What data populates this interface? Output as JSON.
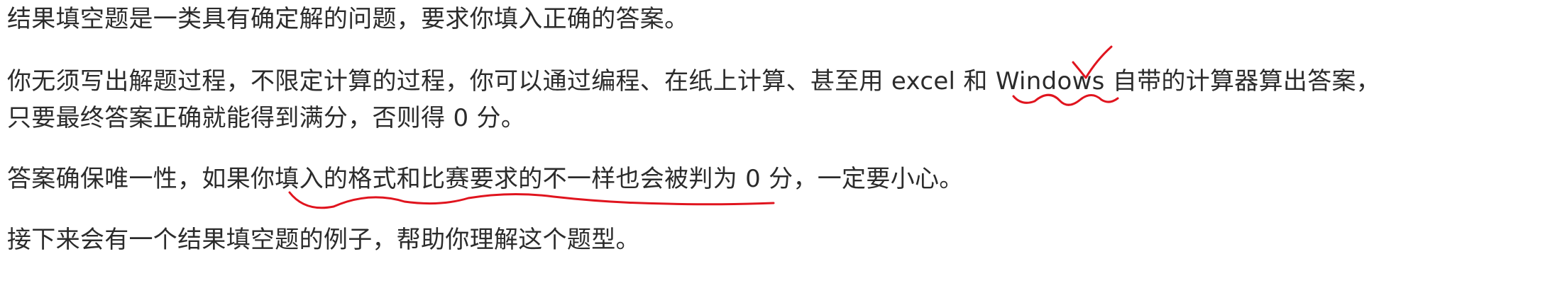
{
  "paragraphs": {
    "p1": "结果填空题是一类具有确定解的问题，要求你填入正确的答案。",
    "p2_line1": "你无须写出解题过程，不限定计算的过程，你可以通过编程、在纸上计算、甚至用 excel 和 Windows 自带的计算器算出答案，",
    "p2_line2": "只要最终答案正确就能得到满分，否则得 0 分。",
    "p3": "答案确保唯一性，如果你填入的格式和比赛要求的不一样也会被判为 0 分，一定要小心。",
    "p4": "接下来会有一个结果填空题的例子，帮助你理解这个题型。"
  },
  "annotations": {
    "color": "#e0141e"
  }
}
